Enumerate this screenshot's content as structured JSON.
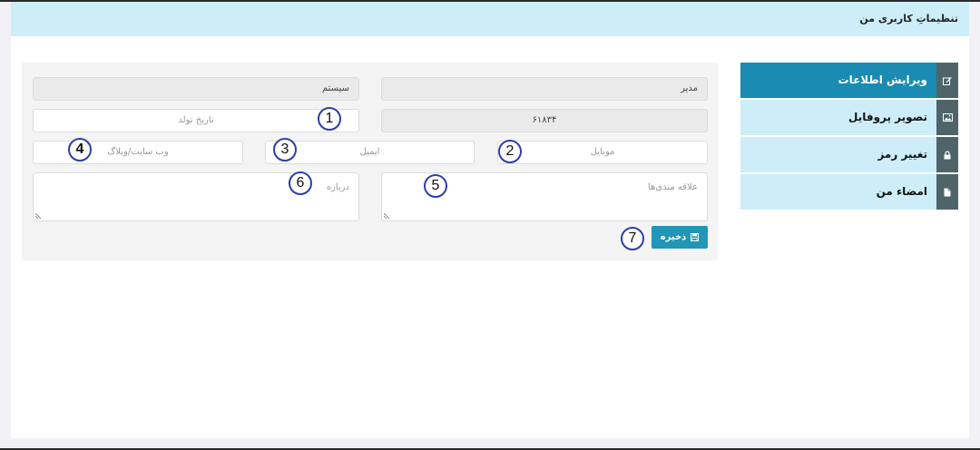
{
  "header": {
    "title": "تنظیماتِ کاربری من"
  },
  "sidebar": {
    "items": [
      {
        "label": "ویرایش اطلاعات",
        "icon": "edit-icon",
        "active": true
      },
      {
        "label": "تصویر پروفایل",
        "icon": "image-icon",
        "active": false
      },
      {
        "label": "تغییر رمز",
        "icon": "lock-icon",
        "active": false
      },
      {
        "label": "امضاء من",
        "icon": "document-icon",
        "active": false
      }
    ]
  },
  "form": {
    "first_name_value": "مدیر",
    "last_name_value": "سیستم",
    "code_value": "۶۱۸۳۴",
    "birthdate_placeholder": "تاریخ تولد",
    "mobile_placeholder": "موبایل",
    "email_placeholder": "ایمیل",
    "website_placeholder": "وب سایت/وبلاگ",
    "interests_placeholder": "علاقه مندی‌ها",
    "about_placeholder": "درباره",
    "save_label": "ذخیره"
  },
  "annotations": [
    "1",
    "2",
    "3",
    "4",
    "5",
    "6",
    "7"
  ],
  "colors": {
    "header_bg": "#cdeef8",
    "accent": "#1a8bb3",
    "save_button": "#2196b6",
    "icon_box": "#4f6469",
    "callout_border": "#2f3ea8"
  }
}
